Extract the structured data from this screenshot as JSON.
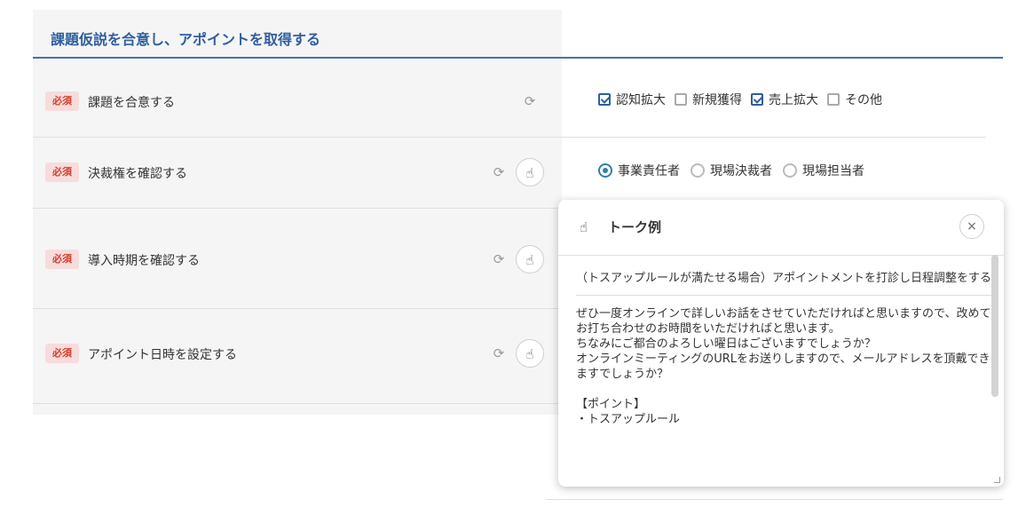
{
  "section": {
    "title": "課題仮説を合意し、アポイントを取得する"
  },
  "rows": [
    {
      "badge": "必須",
      "label": "課題を合意する"
    },
    {
      "badge": "必須",
      "label": "決裁権を確認する"
    },
    {
      "badge": "必須",
      "label": "導入時期を確認する"
    },
    {
      "badge": "必須",
      "label": "アポイント日時を設定する"
    }
  ],
  "checkboxes": [
    {
      "label": "認知拡大",
      "checked": true
    },
    {
      "label": "新規獲得",
      "checked": false
    },
    {
      "label": "売上拡大",
      "checked": true
    },
    {
      "label": "その他",
      "checked": false
    }
  ],
  "radios": [
    {
      "label": "事業責任者",
      "selected": true
    },
    {
      "label": "現場決裁者",
      "selected": false
    },
    {
      "label": "現場担当者",
      "selected": false
    }
  ],
  "popup": {
    "title": "トーク例",
    "close": "×",
    "scenario": "（トスアップルールが満たせる場合）アポイントメントを打診し日程調整をする",
    "body_lines": [
      "ぜひ一度オンラインで詳しいお話をさせていただければと思いますので、改めてお打ち合わせのお時間をいただければと思います。",
      "ちなみにご都合のよろしい曜日はございますでしょうか？",
      "オンラインミーティングのURLをお送りしますので、メールアドレスを頂戴できますでしょうか？"
    ],
    "point_heading": "【ポイント】",
    "point_partial": "・トスアップルール"
  },
  "icons": {
    "check": "check-plus-icon",
    "hand": "hand-pointer-icon",
    "close": "close-icon"
  },
  "colors": {
    "accent": "#2f5e9e",
    "badge_bg": "#f8dcdc",
    "badge_text": "#d0402c",
    "radio": "#2f7fa8"
  }
}
